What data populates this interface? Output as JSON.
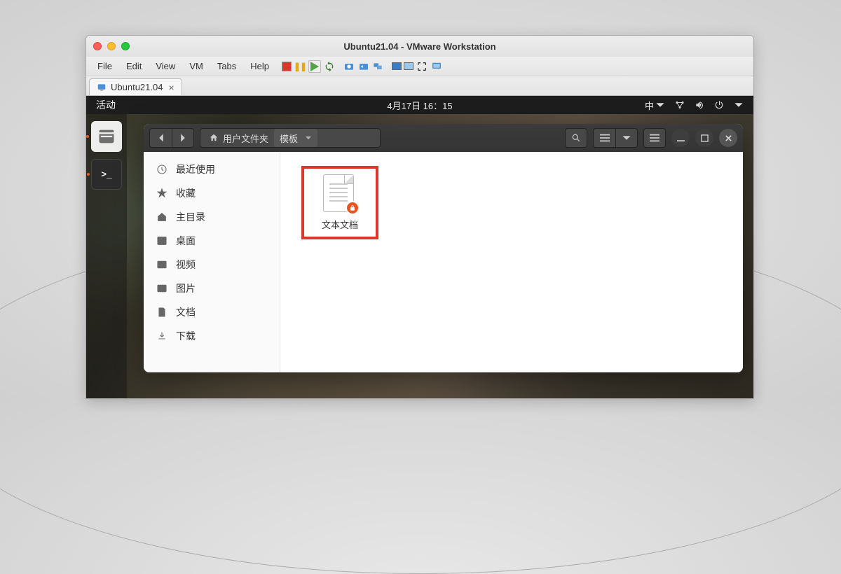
{
  "vmware": {
    "window_title": "Ubuntu21.04 - VMware Workstation",
    "menu": {
      "file": "File",
      "edit": "Edit",
      "view": "View",
      "vm": "VM",
      "tabs": "Tabs",
      "help": "Help"
    },
    "tab": {
      "label": "Ubuntu21.04",
      "close": "×"
    }
  },
  "ubuntu": {
    "activities": "活动",
    "clock": "4月17日  16：15",
    "ime": "中"
  },
  "nautilus": {
    "path": {
      "home": "用户文件夹",
      "current": "模板"
    },
    "sidebar": {
      "recent": "最近使用",
      "starred": "收藏",
      "home": "主目录",
      "desktop": "桌面",
      "videos": "视频",
      "pictures": "图片",
      "documents": "文档",
      "downloads": "下载"
    },
    "file": {
      "name": "文本文档"
    }
  }
}
